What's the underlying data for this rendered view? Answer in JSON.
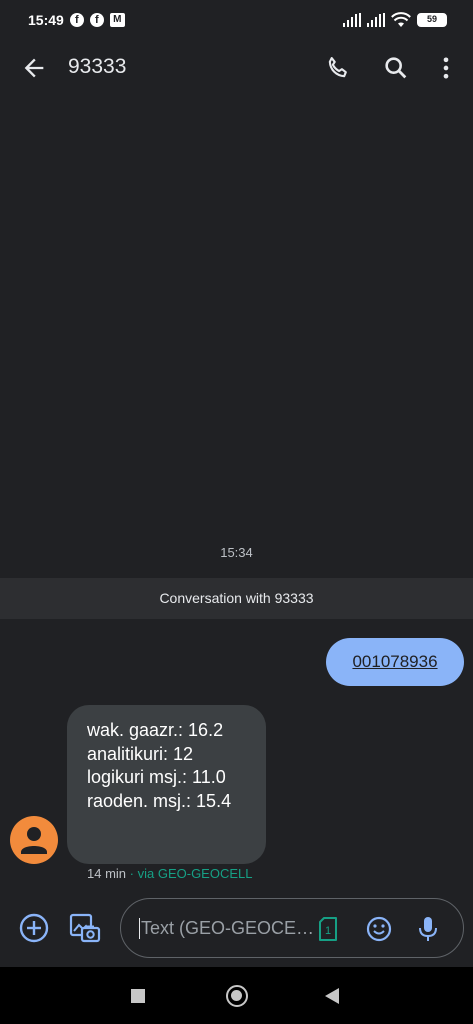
{
  "status_bar": {
    "time": "15:49",
    "notification_icons": [
      "facebook-icon",
      "facebook-icon",
      "gmail-icon"
    ],
    "battery": "59"
  },
  "app_bar": {
    "title": "93333",
    "icons": [
      "back-arrow-icon",
      "phone-icon",
      "search-icon",
      "more-vert-icon"
    ]
  },
  "conversation": {
    "timestamp": "15:34",
    "banner": "Conversation with 93333",
    "outgoing": {
      "text": "001078936"
    },
    "incoming": {
      "lines": [
        "wak. gaazr.: 16.2",
        "analitikuri: 12",
        "logikuri msj.: 11.0",
        "raoden. msj.: 15.4"
      ],
      "time": "14 min",
      "via": "via GEO-GEOCELL"
    }
  },
  "composer": {
    "placeholder": "Text (GEO-GEOCE…",
    "sim_label": "1"
  },
  "colors": {
    "background": "#202124",
    "outgoing_bubble": "#8ab4f8",
    "incoming_bubble": "#3c4043",
    "avatar": "#f28b3c",
    "accent": "#8ab4f8",
    "via": "#16a085"
  }
}
